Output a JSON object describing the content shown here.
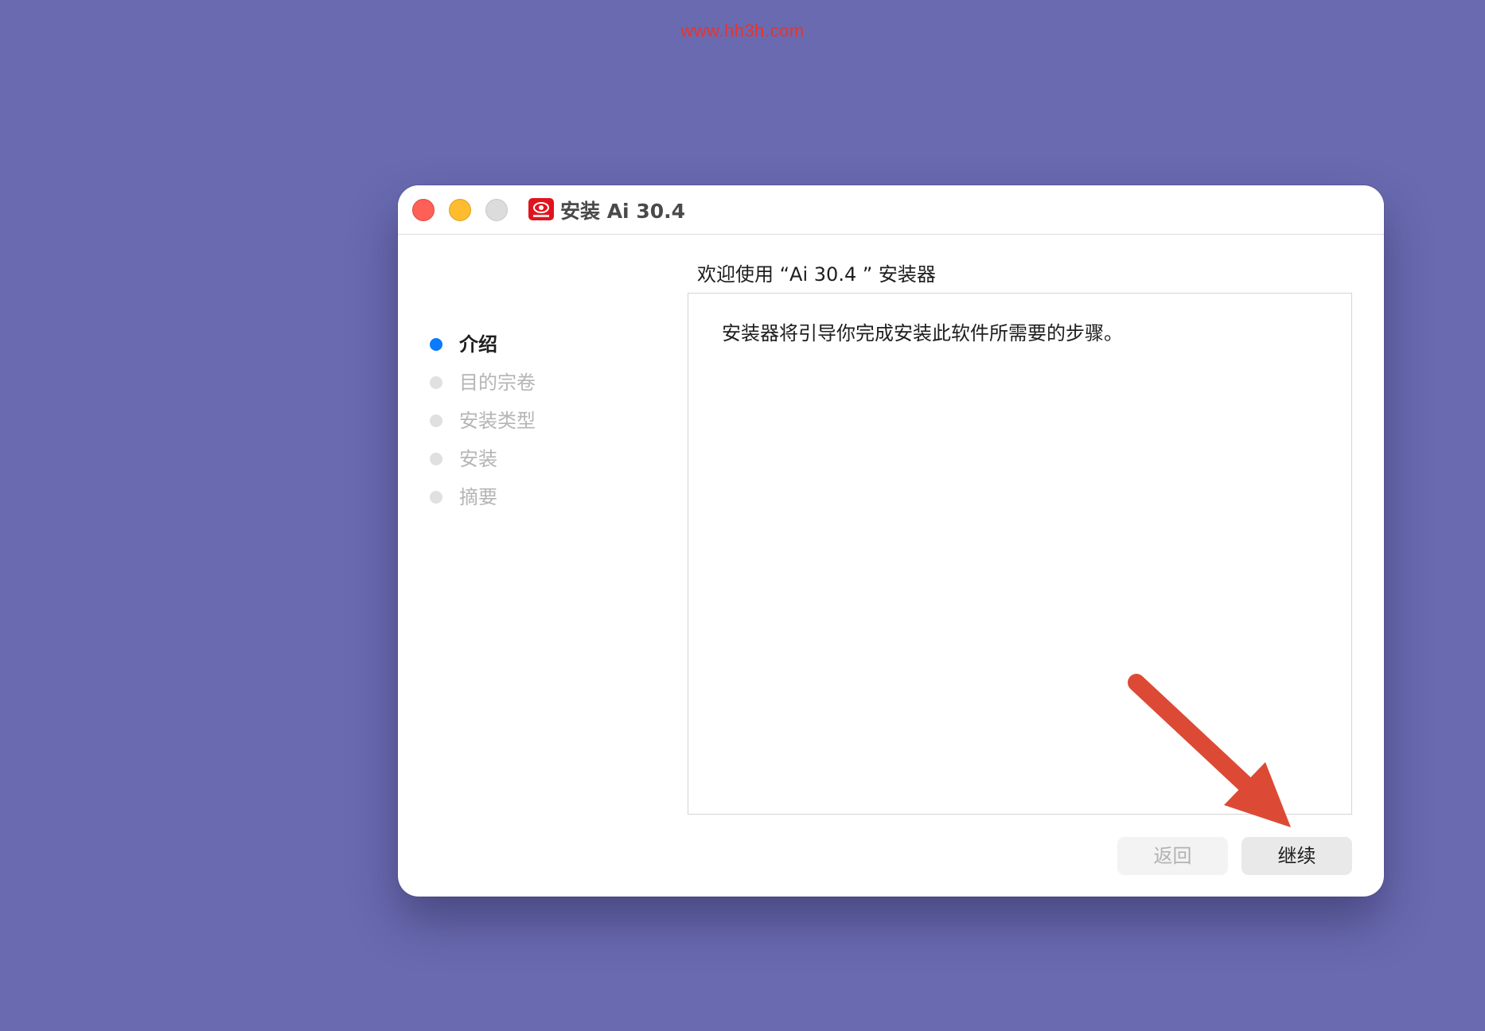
{
  "watermark": "www.hh3h.com",
  "window": {
    "title": "安装 Ai 30.4",
    "heading": "欢迎使用 “Ai 30.4 ” 安装器",
    "body_text": "安装器将引导你完成安装此软件所需要的步骤。"
  },
  "steps": [
    {
      "label": "介绍",
      "active": true
    },
    {
      "label": "目的宗卷",
      "active": false
    },
    {
      "label": "安装类型",
      "active": false
    },
    {
      "label": "安装",
      "active": false
    },
    {
      "label": "摘要",
      "active": false
    }
  ],
  "buttons": {
    "back": "返回",
    "continue": "继续"
  },
  "colors": {
    "background": "#6a6ab1",
    "active_step": "#0a7aff",
    "arrow": "#dc4a35",
    "watermark": "#e8342c"
  },
  "icons": {
    "app": "app-logo-icon",
    "arrow": "red-pointer-arrow"
  }
}
